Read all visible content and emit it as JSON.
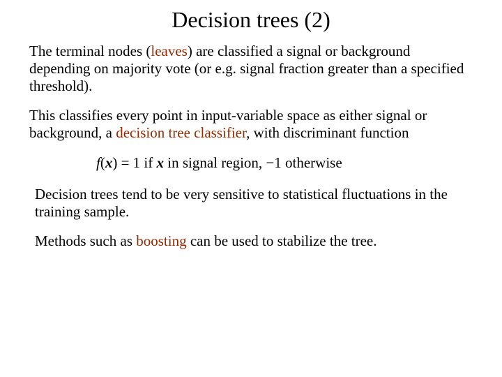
{
  "title": "Decision trees (2)",
  "p1": {
    "t1": "The terminal nodes (",
    "leaves": "leaves",
    "t2": ") are classified a signal or background depending on majority vote (or e.g. signal fraction greater than a specified threshold)."
  },
  "p2": {
    "t1": "This classifies every point in input-variable space as either signal or background, a ",
    "term": "decision tree classifier",
    "t2": ", with discriminant function"
  },
  "formula": {
    "f": "f",
    "open": "(",
    "x1": "x",
    "mid": ") = 1 if ",
    "x2": "x",
    "tail": " in signal region, −1 otherwise"
  },
  "p3": "Decision trees tend to be very sensitive to statistical fluctuations in the training sample.",
  "p4": {
    "t1": "Methods such as ",
    "boosting": "boosting",
    "t2": " can be used to stabilize the tree."
  }
}
